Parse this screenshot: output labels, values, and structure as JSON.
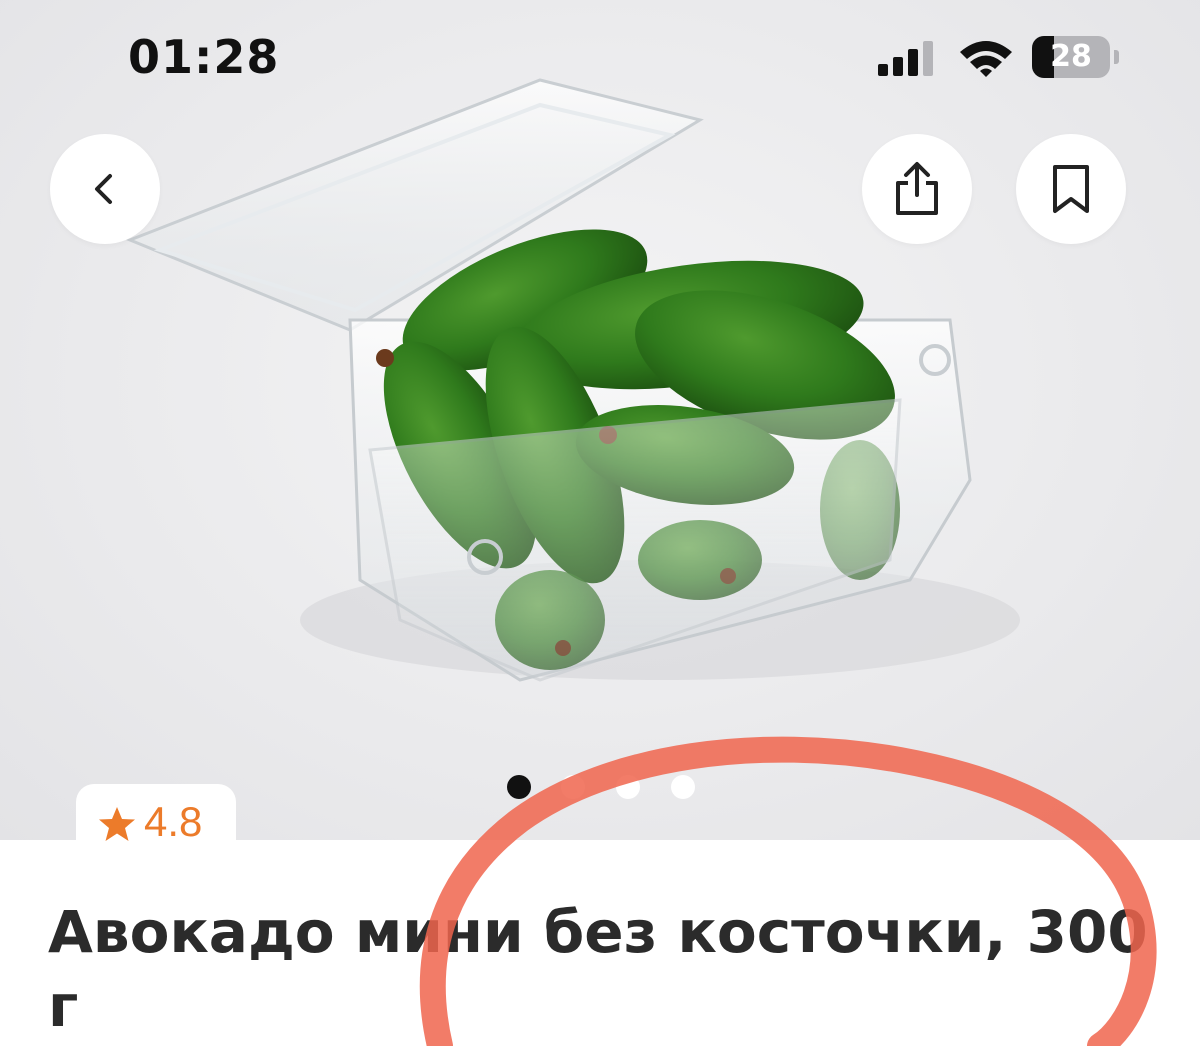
{
  "status_bar": {
    "time": "01:28",
    "battery_level": "28",
    "battery_fraction": 0.28,
    "icons": [
      "cellular-signal-icon",
      "wifi-icon",
      "battery-icon"
    ]
  },
  "top_actions": {
    "back": "chevron-left-icon",
    "share": "share-icon",
    "bookmark": "bookmark-icon"
  },
  "gallery": {
    "page_count": 4,
    "active_index": 0,
    "image_subject": "avocado-photo"
  },
  "rating": {
    "value": "4.8",
    "icon": "star-icon"
  },
  "product": {
    "title": "Авокадо мини без косточки, 300 г"
  },
  "colors": {
    "rating_accent": "#ec7b2a",
    "annotation_ring": "#f0654e",
    "dot_active": "#111111",
    "dot_inactive": "#ffffff"
  }
}
